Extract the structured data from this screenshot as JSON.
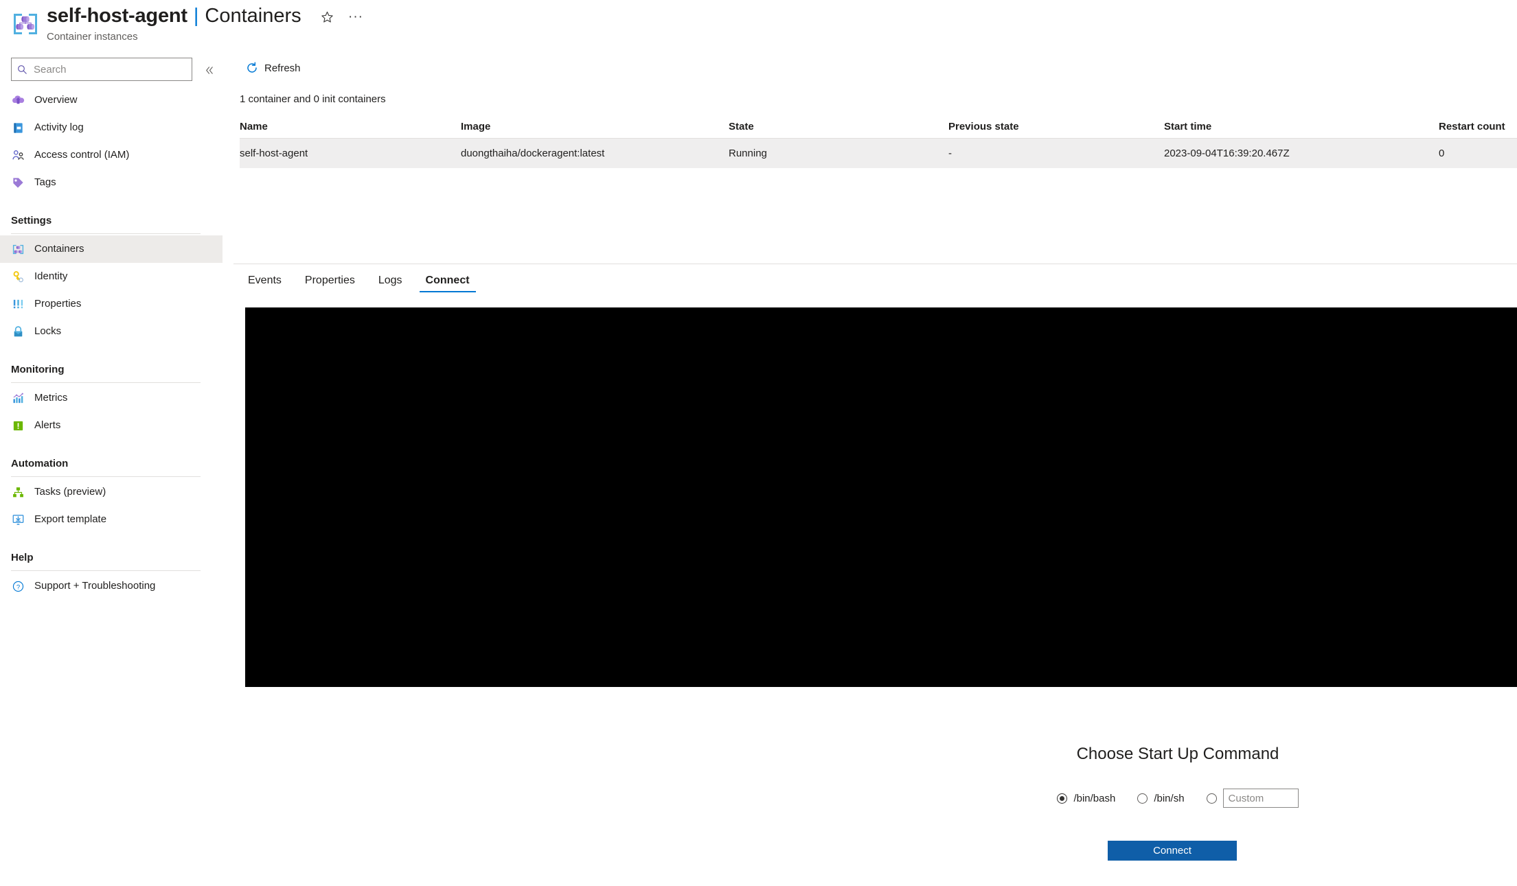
{
  "header": {
    "resource_icon": "container-instances-icon",
    "title_main": "self-host-agent",
    "title_separator": "|",
    "title_sub": "Containers",
    "resource_type": "Container instances",
    "favorite_icon": "star-icon",
    "more_icon": "ellipsis-icon"
  },
  "sidebar": {
    "search": {
      "value": "",
      "placeholder": "Search",
      "icon": "search-icon"
    },
    "collapse_icon": "double-chevron-left-icon",
    "items": [
      {
        "label": "Overview",
        "icon": "overview-icon",
        "type": "item",
        "selected": false
      },
      {
        "label": "Activity log",
        "icon": "activity-log-icon",
        "type": "item",
        "selected": false
      },
      {
        "label": "Access control (IAM)",
        "icon": "access-control-icon",
        "type": "item",
        "selected": false
      },
      {
        "label": "Tags",
        "icon": "tags-icon",
        "type": "item",
        "selected": false
      },
      {
        "label": "Settings",
        "type": "group"
      },
      {
        "label": "Containers",
        "icon": "containers-icon",
        "type": "item",
        "selected": true
      },
      {
        "label": "Identity",
        "icon": "identity-key-icon",
        "type": "item",
        "selected": false
      },
      {
        "label": "Properties",
        "icon": "properties-icon",
        "type": "item",
        "selected": false
      },
      {
        "label": "Locks",
        "icon": "lock-icon",
        "type": "item",
        "selected": false
      },
      {
        "label": "Monitoring",
        "type": "group"
      },
      {
        "label": "Metrics",
        "icon": "metrics-chart-icon",
        "type": "item",
        "selected": false
      },
      {
        "label": "Alerts",
        "icon": "alerts-icon",
        "type": "item",
        "selected": false
      },
      {
        "label": "Automation",
        "type": "group"
      },
      {
        "label": "Tasks (preview)",
        "icon": "tasks-icon",
        "type": "item",
        "selected": false
      },
      {
        "label": "Export template",
        "icon": "export-template-icon",
        "type": "item",
        "selected": false
      },
      {
        "label": "Help",
        "type": "group"
      },
      {
        "label": "Support + Troubleshooting",
        "icon": "question-circle-icon",
        "type": "item",
        "selected": false
      }
    ]
  },
  "commandbar": {
    "refresh_label": "Refresh",
    "refresh_icon": "refresh-icon"
  },
  "main": {
    "count_text": "1 container and 0 init containers",
    "table": {
      "columns": [
        "Name",
        "Image",
        "State",
        "Previous state",
        "Start time",
        "Restart count"
      ],
      "rows": [
        {
          "name": "self-host-agent",
          "image": "duongthaiha/dockeragent:latest",
          "state": "Running",
          "previous_state": "-",
          "start_time": "2023-09-04T16:39:20.467Z",
          "restart_count": "0"
        }
      ]
    },
    "tabs": [
      {
        "label": "Events",
        "active": false
      },
      {
        "label": "Properties",
        "active": false
      },
      {
        "label": "Logs",
        "active": false
      },
      {
        "label": "Connect",
        "active": true
      }
    ]
  },
  "modal": {
    "title": "Choose Start Up Command",
    "options": [
      {
        "label": "/bin/bash",
        "checked": true
      },
      {
        "label": "/bin/sh",
        "checked": false
      },
      {
        "label": "",
        "checked": false,
        "custom_input": {
          "value": "",
          "placeholder": "Custom"
        }
      }
    ],
    "connect_label": "Connect"
  },
  "colors": {
    "accent": "#0078d4",
    "button_primary": "#0f5ea8",
    "selected_row": "#efeeee",
    "selected_nav": "#edebe9",
    "terminal_bg": "#000000"
  }
}
